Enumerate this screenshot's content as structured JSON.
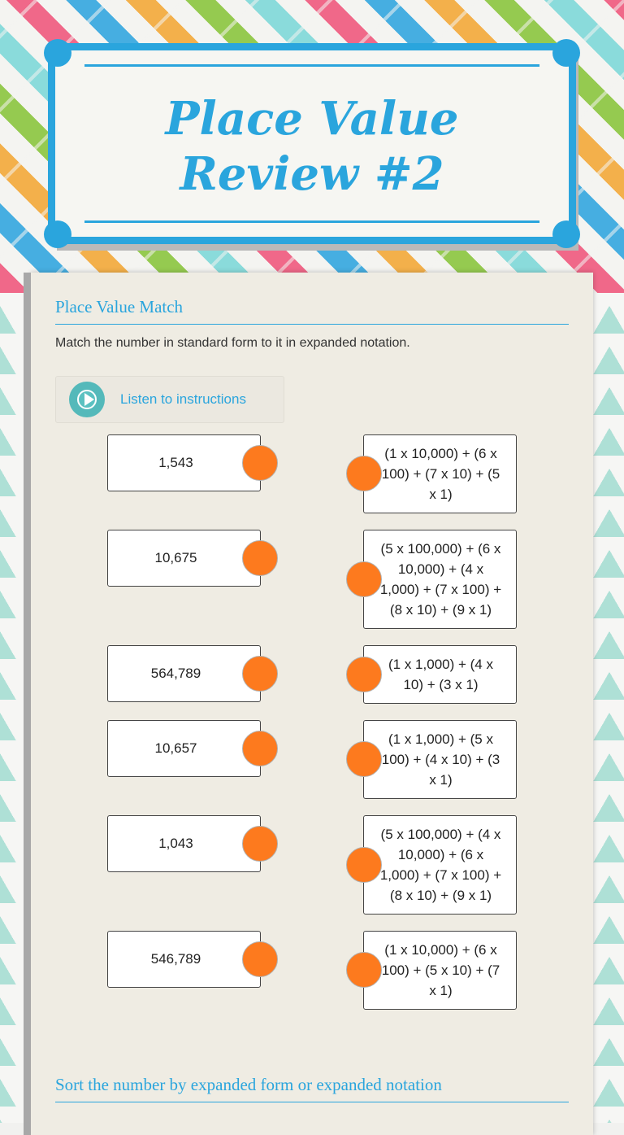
{
  "title": "Place Value Review #2",
  "section1": {
    "heading": "Place Value Match",
    "instructions": "Match the number in standard form to it in expanded notation.",
    "listen_label": "Listen to instructions"
  },
  "left_items": [
    "1,543",
    "10,675",
    "564,789",
    "10,657",
    "1,043",
    "546,789"
  ],
  "right_items": [
    "(1 x 10,000) + (6 x 100) + (7 x 10) + (5 x 1)",
    "(5 x 100,000) + (6 x 10,000) + (4 x 1,000) + (7 x 100) + (8 x 10) + (9 x 1)",
    "(1 x 1,000) + (4 x 10) + (3 x 1)",
    "(1 x 1,000) + (5 x 100) + (4 x 10) + (3 x 1)",
    "(5 x 100,000) + (4 x 10,000) + (6 x 1,000) + (7 x 100) + (8 x 10) + (9 x 1)",
    "(1 x 10,000) + (6 x 100) + (5 x 10) + (7 x 1)"
  ],
  "section2": {
    "heading": "Sort the number by expanded form or expanded notation"
  },
  "colors": {
    "accent": "#2aa5dd",
    "match_dot": "#fd7a1e",
    "play_button": "#54b9ba"
  }
}
